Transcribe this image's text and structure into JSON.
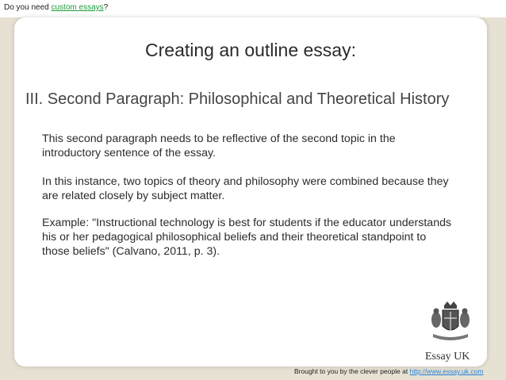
{
  "top_note": {
    "prefix": "Do you need ",
    "link": "custom essays",
    "suffix": "?"
  },
  "slide": {
    "title": "Creating an outline essay:",
    "section_heading": "III. Second Paragraph: Philosophical and Theoretical History",
    "paragraphs": [
      "This second paragraph needs to be reflective of the second topic in the introductory sentence of the essay.",
      "In this instance, two topics of theory and philosophy were combined because they are related closely by subject matter.",
      "Example: \"Instructional technology is best for students if the educator understands his or her pedagogical philosophical beliefs and their theoretical standpoint to those beliefs\" (Calvano, 2011, p. 3)."
    ]
  },
  "logo": {
    "text": "Essay UK"
  },
  "credit": {
    "prefix": "Brought to you by the clever people at ",
    "link": "http://www.essay.uk.com"
  }
}
